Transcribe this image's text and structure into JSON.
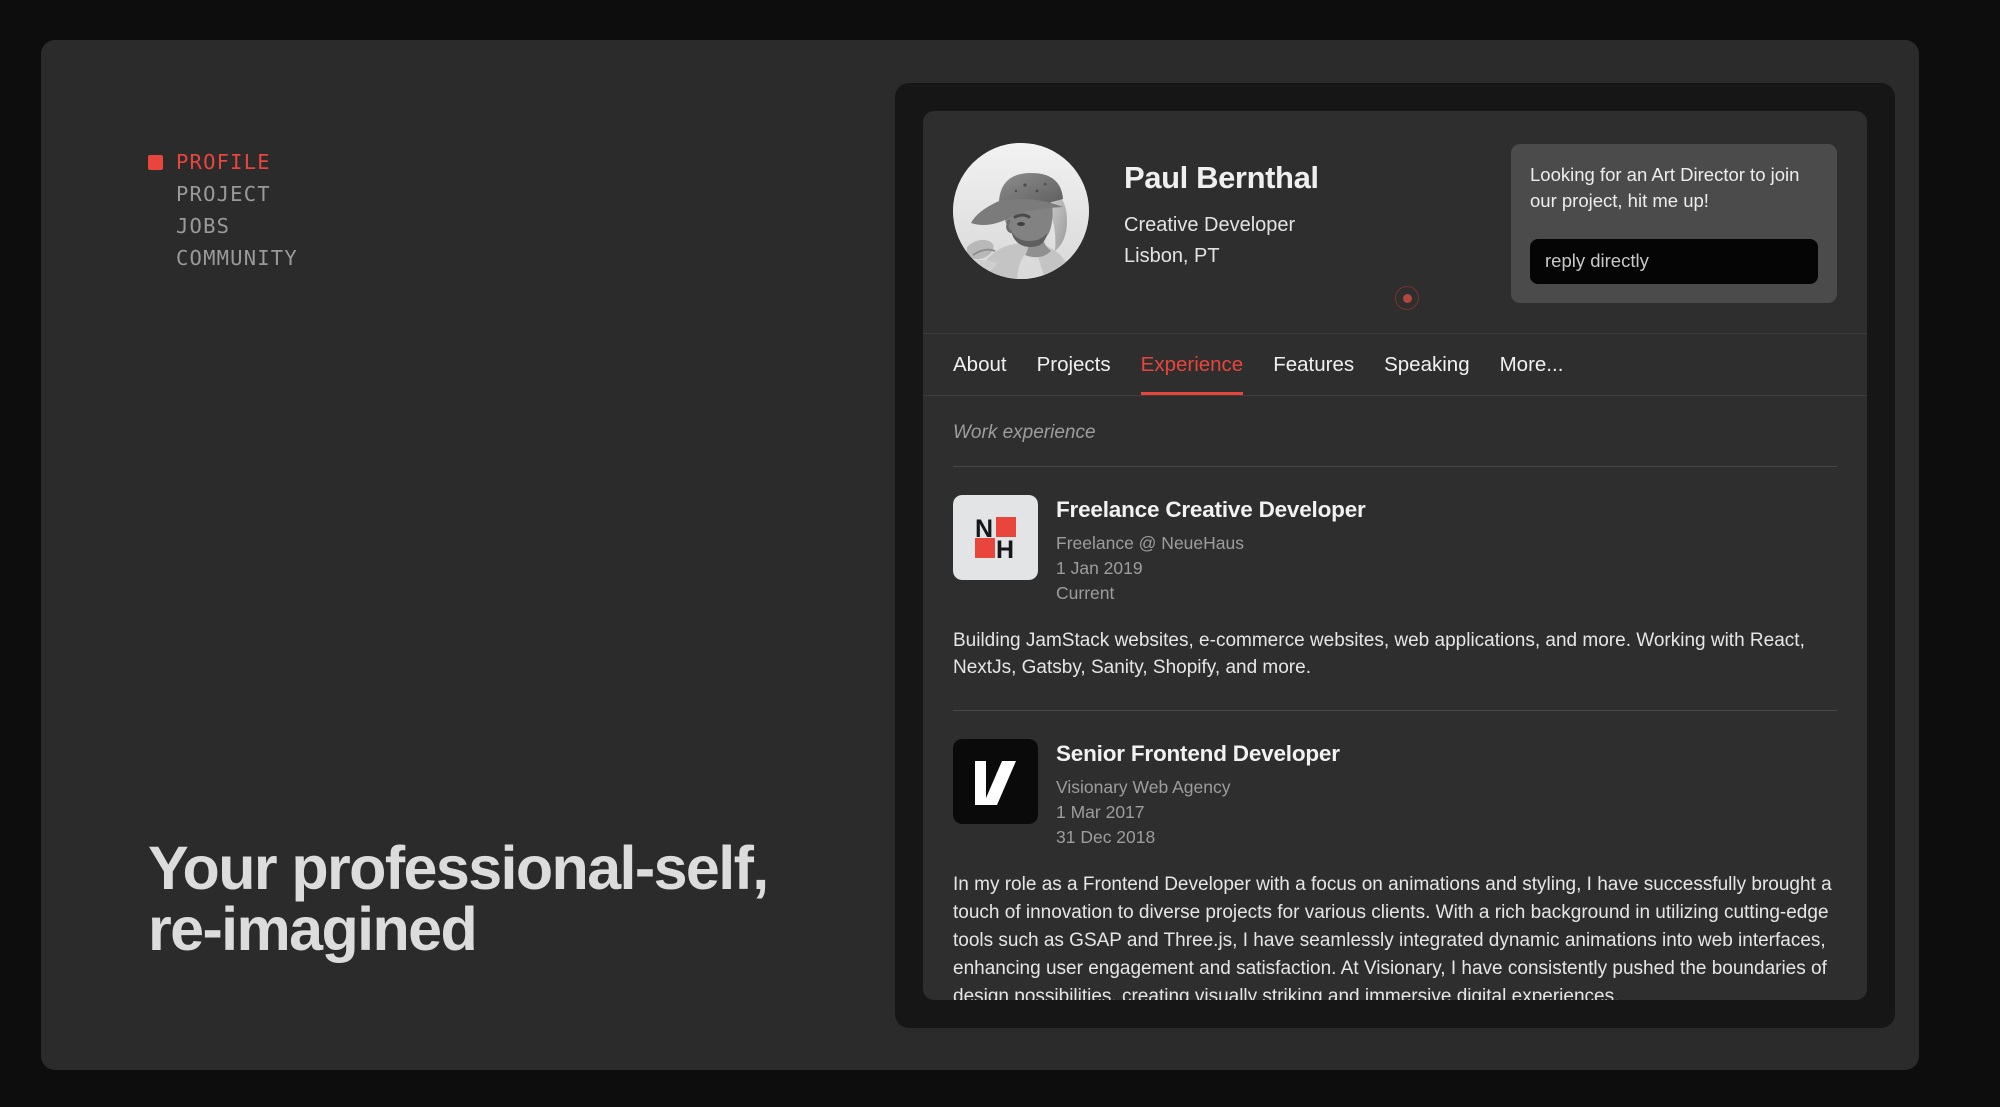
{
  "nav": {
    "items": [
      {
        "label": "PROFILE",
        "active": true
      },
      {
        "label": "PROJECT",
        "active": false
      },
      {
        "label": "JOBS",
        "active": false
      },
      {
        "label": "COMMUNITY",
        "active": false
      }
    ]
  },
  "headline": "Your professional-self, re-imagined",
  "profile": {
    "name": "Paul Bernthal",
    "role": "Creative Developer",
    "location": "Lisbon, PT",
    "avatar_alt": "portrait-photo"
  },
  "message": {
    "text": "Looking for an Art Director to join our project, hit me up!",
    "reply_placeholder": "reply directly",
    "reply_value": ""
  },
  "tabs": [
    {
      "label": "About",
      "active": false
    },
    {
      "label": "Projects",
      "active": false
    },
    {
      "label": "Experience",
      "active": true
    },
    {
      "label": "Features",
      "active": false
    },
    {
      "label": "Speaking",
      "active": false
    },
    {
      "label": "More...",
      "active": false
    }
  ],
  "experience": {
    "section_label": "Work experience",
    "jobs": [
      {
        "title": "Freelance Creative Developer",
        "company": "Freelance @ NeueHaus",
        "start": "1 Jan 2019",
        "end": "Current",
        "description": "Building JamStack websites, e-commerce websites, web applications, and more. Working with React, NextJs, Gatsby, Sanity, Shopify, and more.",
        "logo": "neuehaus-logo"
      },
      {
        "title": "Senior Frontend Developer",
        "company": "Visionary Web Agency",
        "start": "1 Mar 2017",
        "end": "31 Dec 2018",
        "description": "In my role as a Frontend Developer with a focus on animations and styling, I have successfully brought a touch of innovation to diverse projects for various clients. With a rich background in utilizing cutting-edge tools such as GSAP and Three.js, I have seamlessly integrated dynamic animations into web interfaces, enhancing user engagement and satisfaction. At Visionary, I have consistently pushed the boundaries of design possibilities, creating visually striking and immersive digital experiences.",
        "logo": "visionary-logo"
      }
    ]
  },
  "colors": {
    "accent": "#e8453c",
    "page_bg": "#0d0d0d",
    "panel_bg": "#2b2b2b",
    "card_bg": "#2e2e2e",
    "shell_bg": "#161616",
    "message_bg": "#4b4b4b",
    "input_bg": "#050505"
  }
}
